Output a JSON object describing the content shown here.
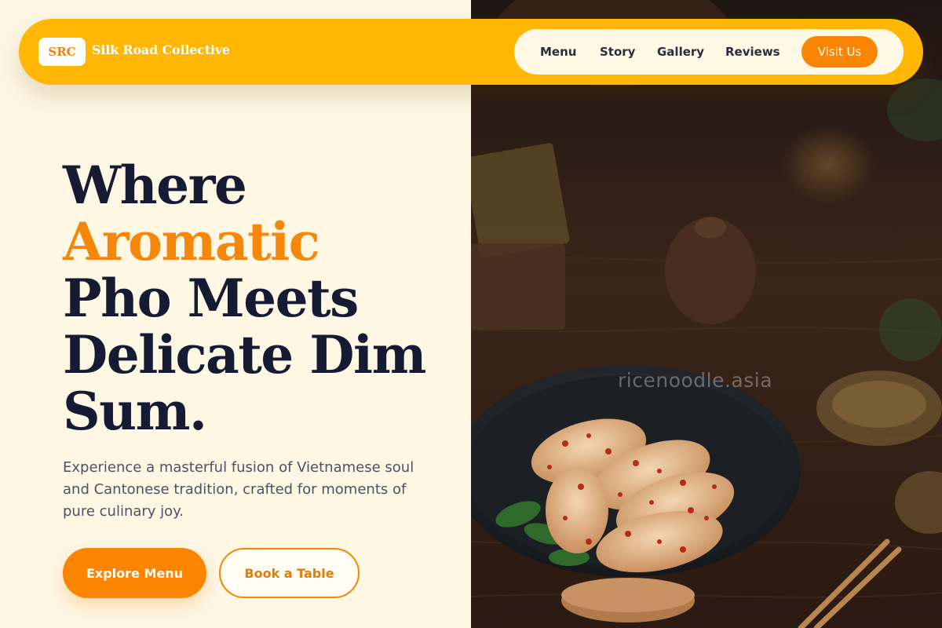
{
  "brand": {
    "badge": "SRC",
    "name": "Silk Road Collective"
  },
  "nav": {
    "links": [
      "Menu",
      "Story",
      "Gallery",
      "Reviews"
    ],
    "cta": "Visit Us"
  },
  "hero": {
    "headline_lines": [
      "Where",
      "Aromatic",
      "Pho Meets",
      "Delicate Dim",
      "Sum."
    ],
    "headline_accent_line": "Aromatic",
    "subtext": "Experience a masterful fusion of Vietnamese soul and Cantonese tradition, crafted for moments of pure culinary joy.",
    "primary_button": "Explore Menu",
    "secondary_button": "Book a Table",
    "image_watermark": "ricenoodle.asia"
  },
  "colors": {
    "nav_background": "#ffb703",
    "accent_orange": "#fb8500",
    "heading_navy": "#141b33",
    "page_background": "#fdf7e4"
  },
  "icons": {
    "hero_image": "dumplings-bowl-photo"
  }
}
